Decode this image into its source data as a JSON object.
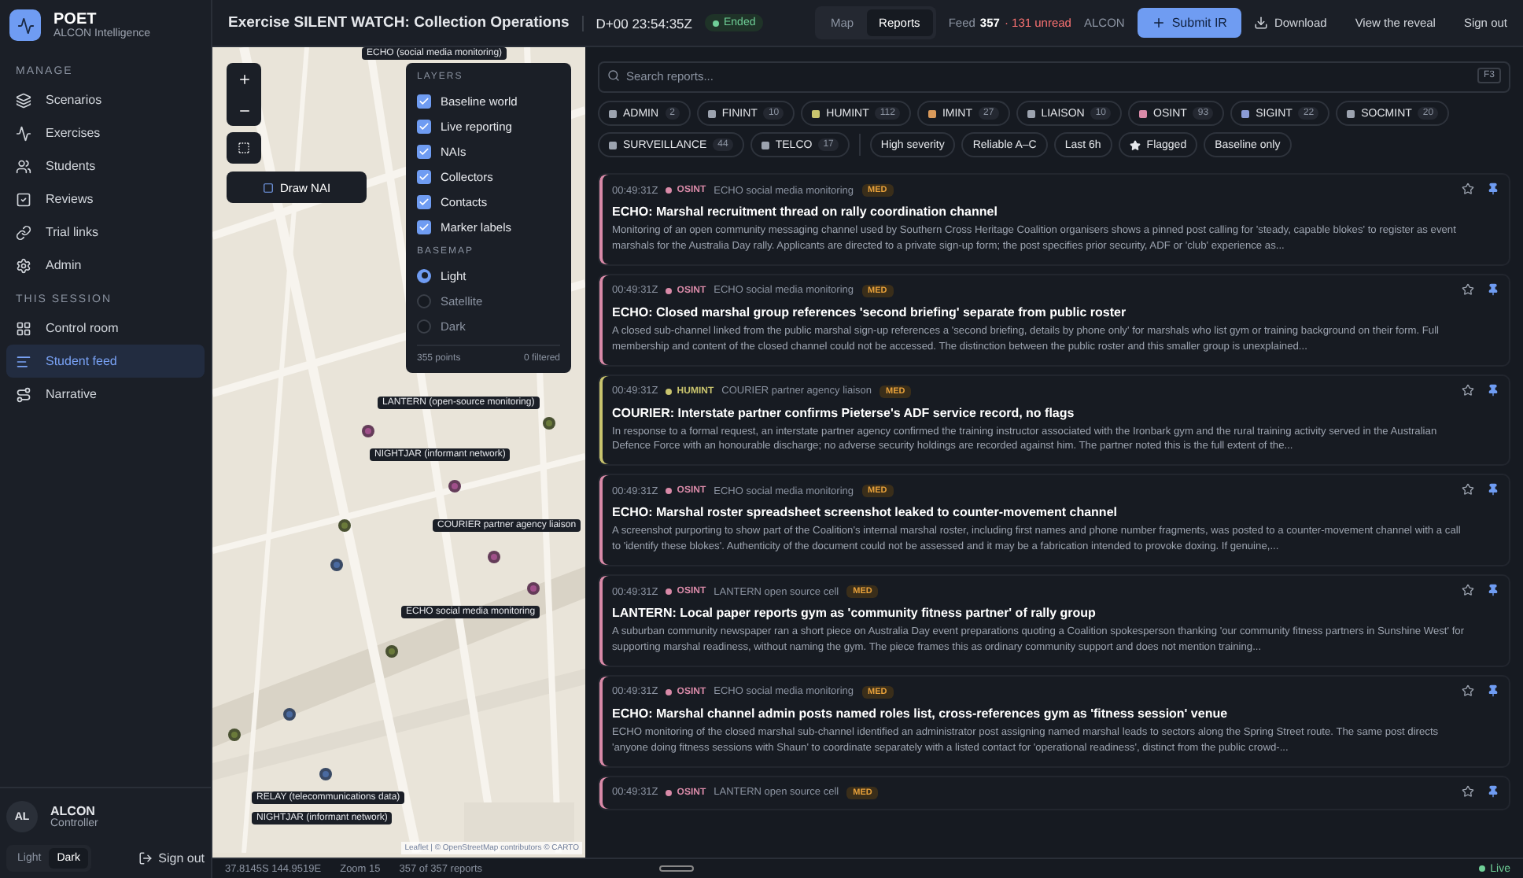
{
  "brand": {
    "name": "POET",
    "subtitle": "ALCON Intelligence"
  },
  "sidebar": {
    "sections": [
      {
        "title": "MANAGE",
        "items": [
          {
            "label": "Scenarios",
            "selected": false
          },
          {
            "label": "Exercises",
            "selected": false
          },
          {
            "label": "Students",
            "selected": false
          },
          {
            "label": "Reviews",
            "selected": false
          },
          {
            "label": "Trial links",
            "selected": false
          },
          {
            "label": "Admin",
            "selected": false
          }
        ]
      },
      {
        "title": "THIS SESSION",
        "items": [
          {
            "label": "Control room",
            "selected": false
          },
          {
            "label": "Student feed",
            "selected": true
          },
          {
            "label": "Narrative",
            "selected": false
          }
        ]
      }
    ],
    "user": {
      "initials": "AL",
      "name": "ALCON",
      "role": "Controller"
    },
    "theme": [
      {
        "label": "Light",
        "selected": false
      },
      {
        "label": "Dark",
        "selected": true
      }
    ],
    "sign_out": "Sign out"
  },
  "header": {
    "title": "Exercise SILENT WATCH: Collection Operations",
    "clock": "D+00 23:54:35Z",
    "status": "Ended",
    "views": [
      {
        "label": "Map",
        "selected": false
      },
      {
        "label": "Reports",
        "selected": true
      }
    ],
    "feed_label": "Feed",
    "feed_count": "357",
    "unread": "· 131 unread",
    "role": "ALCON",
    "submit": "Submit IR",
    "download": "Download",
    "reveal": "View the reveal",
    "sign_out": "Sign out"
  },
  "map": {
    "draw_button": "Draw NAI",
    "layers": {
      "title": "LAYERS",
      "items": [
        {
          "label": "Baseline world",
          "checked": true
        },
        {
          "label": "Live reporting",
          "checked": true
        },
        {
          "label": "NAIs",
          "checked": true
        },
        {
          "label": "Collectors",
          "checked": true
        },
        {
          "label": "Contacts",
          "checked": true
        },
        {
          "label": "Marker labels",
          "checked": true
        }
      ],
      "basemap_title": "BASEMAP",
      "basemaps": [
        {
          "label": "Light",
          "selected": true
        },
        {
          "label": "Satellite",
          "selected": false
        },
        {
          "label": "Dark",
          "selected": false
        }
      ],
      "points": "355 points",
      "filtered": "0 filtered"
    },
    "labels": [
      "ECHO (social media monitoring)",
      "LANTERN (open-source monitoring)",
      "NIGHTJAR (informant network)",
      "COURIER partner agency liaison",
      "ECHO social media monitoring",
      "RELAY (telecommunications data)",
      "NIGHTJAR (informant network)"
    ],
    "markers": [
      {
        "color": "#a0508a"
      },
      {
        "color": "#6a7a3a"
      },
      {
        "color": "#a0508a"
      },
      {
        "color": "#6a7a3a"
      },
      {
        "color": "#4a6aa0"
      },
      {
        "color": "#a0508a"
      },
      {
        "color": "#6a7a3a"
      },
      {
        "color": "#4a6aa0"
      },
      {
        "color": "#6a7a3a"
      },
      {
        "color": "#a0508a"
      },
      {
        "color": "#4a6aa0"
      }
    ],
    "attribution": "Leaflet | © OpenStreetMap contributors © CARTO"
  },
  "search": {
    "placeholder": "Search reports...",
    "shortcut": "F3"
  },
  "disciplines": [
    {
      "label": "ADMIN",
      "count": "2",
      "color": "#9ca3af"
    },
    {
      "label": "FININT",
      "count": "10",
      "color": "#9ca3af"
    },
    {
      "label": "HUMINT",
      "count": "112",
      "color": "#c9c46e"
    },
    {
      "label": "IMINT",
      "count": "27",
      "color": "#d9995a"
    },
    {
      "label": "LIAISON",
      "count": "10",
      "color": "#9ca3af"
    },
    {
      "label": "OSINT",
      "count": "93",
      "color": "#d98aa8"
    },
    {
      "label": "SIGINT",
      "count": "22",
      "color": "#8a9bd6"
    },
    {
      "label": "SOCMINT",
      "count": "20",
      "color": "#9ca3af"
    },
    {
      "label": "SURVEILLANCE",
      "count": "44",
      "color": "#9ca3af"
    },
    {
      "label": "TELCO",
      "count": "17",
      "color": "#9ca3af"
    }
  ],
  "filters": [
    {
      "label": "High severity",
      "kind": "plain"
    },
    {
      "label": "Reliable A–C",
      "kind": "plain"
    },
    {
      "label": "Last 6h",
      "kind": "plain"
    },
    {
      "label": "Flagged",
      "kind": "star"
    },
    {
      "label": "Baseline only",
      "kind": "plain"
    }
  ],
  "reports": [
    {
      "time": "00:49:31Z",
      "source": "OSINT",
      "color": "#d98aa8",
      "collector": "ECHO social media monitoring",
      "severity": "MED",
      "title": "ECHO: Marshal recruitment thread on rally coordination channel",
      "body": "Monitoring of an open community messaging channel used by Southern Cross Heritage Coalition organisers shows a pinned post calling for 'steady, capable blokes' to register as event marshals for the Australia Day rally. Applicants are directed to a private sign-up form; the post specifies prior security, ADF or 'club' experience as..."
    },
    {
      "time": "00:49:31Z",
      "source": "OSINT",
      "color": "#d98aa8",
      "collector": "ECHO social media monitoring",
      "severity": "MED",
      "title": "ECHO: Closed marshal group references 'second briefing' separate from public roster",
      "body": "A closed sub-channel linked from the public marshal sign-up references a 'second briefing, details by phone only' for marshals who list gym or training background on their form. Full membership and content of the closed channel could not be accessed. The distinction between the public roster and this smaller group is unexplained..."
    },
    {
      "time": "00:49:31Z",
      "source": "HUMINT",
      "color": "#c9c46e",
      "collector": "COURIER partner agency liaison",
      "severity": "MED",
      "title": "COURIER: Interstate partner confirms Pieterse's ADF service record, no flags",
      "body": "In response to a formal request, an interstate partner agency confirmed the training instructor associated with the Ironbark gym and the rural training activity served in the Australian Defence Force with an honourable discharge; no adverse security holdings are recorded against him. The partner noted this is the full extent of the..."
    },
    {
      "time": "00:49:31Z",
      "source": "OSINT",
      "color": "#d98aa8",
      "collector": "ECHO social media monitoring",
      "severity": "MED",
      "title": "ECHO: Marshal roster spreadsheet screenshot leaked to counter-movement channel",
      "body": "A screenshot purporting to show part of the Coalition's internal marshal roster, including first names and phone number fragments, was posted to a counter-movement channel with a call to 'identify these blokes'. Authenticity of the document could not be assessed and it may be a fabrication intended to provoke doxing. If genuine,..."
    },
    {
      "time": "00:49:31Z",
      "source": "OSINT",
      "color": "#d98aa8",
      "collector": "LANTERN open source cell",
      "severity": "MED",
      "title": "LANTERN: Local paper reports gym as 'community fitness partner' of rally group",
      "body": "A suburban community newspaper ran a short piece on Australia Day event preparations quoting a Coalition spokesperson thanking 'our community fitness partners in Sunshine West' for supporting marshal readiness, without naming the gym. The piece frames this as ordinary community support and does not mention training..."
    },
    {
      "time": "00:49:31Z",
      "source": "OSINT",
      "color": "#d98aa8",
      "collector": "ECHO social media monitoring",
      "severity": "MED",
      "title": "ECHO: Marshal channel admin posts named roles list, cross-references gym as 'fitness session' venue",
      "body": "ECHO monitoring of the closed marshal sub-channel identified an administrator post assigning named marshal leads to sectors along the Spring Street route. The same post directs 'anyone doing fitness sessions with Shaun' to coordinate separately with a listed contact for 'operational readiness', distinct from the public crowd-..."
    },
    {
      "time": "00:49:31Z",
      "source": "OSINT",
      "color": "#d98aa8",
      "collector": "LANTERN open source cell",
      "severity": "MED"
    }
  ],
  "status_bar": {
    "coords": "37.8145S 144.9519E",
    "zoom": "Zoom 15",
    "reports": "357 of 357 reports",
    "live": "Live"
  }
}
